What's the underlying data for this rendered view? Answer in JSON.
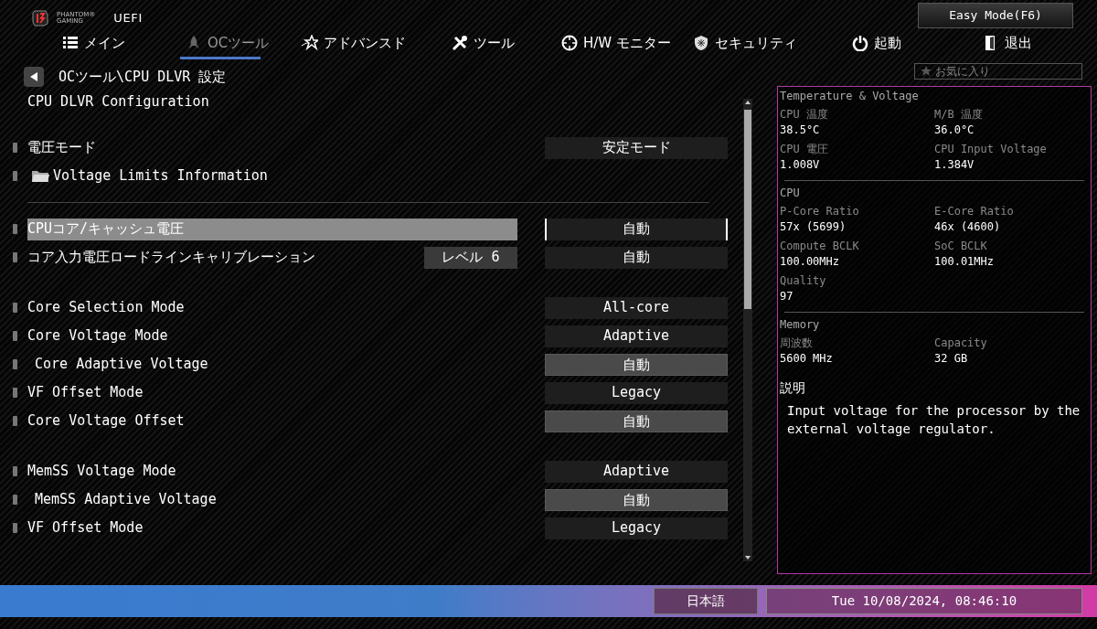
{
  "header": {
    "logo_brand": "PHANTOM®",
    "logo_sub": "GAMING",
    "product": "UEFI",
    "easy_mode_button": "Easy Mode(F6)"
  },
  "tabs": [
    {
      "label": "メイン",
      "selected": false
    },
    {
      "label": "OCツール",
      "selected": true
    },
    {
      "label": "アドバンスド",
      "selected": false
    },
    {
      "label": "ツール",
      "selected": false
    },
    {
      "label": "H/W モニター",
      "selected": false
    },
    {
      "label": "セキュリティ",
      "selected": false
    },
    {
      "label": "起動",
      "selected": false
    },
    {
      "label": "退出",
      "selected": false
    }
  ],
  "favorites": "お気に入り",
  "breadcrumb": "OCツール\\CPU DLVR 設定",
  "section_title": "CPU DLVR Configuration",
  "groups": [
    {
      "items": [
        {
          "kind": "option",
          "label": "電圧モード",
          "value": "安定モード",
          "editable": false,
          "selected": false
        },
        {
          "kind": "folder",
          "label": "Voltage Limits Information",
          "selected": false
        },
        {
          "kind": "divider"
        }
      ]
    },
    {
      "items": [
        {
          "kind": "option",
          "label": "CPUコア/キャッシュ電圧",
          "value": "自動",
          "editable": false,
          "selected": true
        },
        {
          "kind": "option",
          "label": "コア入力電圧ロードラインキャリブレーション",
          "reading": "レベル 6",
          "value": "自動",
          "editable": false,
          "selected": false
        }
      ]
    },
    {
      "items": [
        {
          "kind": "option",
          "label": "Core Selection Mode",
          "value": "All-core",
          "editable": false,
          "selected": false
        },
        {
          "kind": "option",
          "label": "Core Voltage Mode",
          "value": "Adaptive",
          "editable": false,
          "selected": false,
          "children": [
            {
              "kind": "option",
              "label": "Core Adaptive Voltage",
              "value": "自動",
              "editable": true,
              "selected": false
            }
          ]
        },
        {
          "kind": "option",
          "label": "VF Offset Mode",
          "value": "Legacy",
          "editable": false,
          "selected": false
        },
        {
          "kind": "option",
          "label": "Core Voltage Offset",
          "value": "自動",
          "editable": true,
          "selected": false
        }
      ]
    },
    {
      "items": [
        {
          "kind": "option",
          "label": "MemSS Voltage Mode",
          "value": "Adaptive",
          "editable": false,
          "selected": false,
          "children": [
            {
              "kind": "option",
              "label": "MemSS Adaptive Voltage",
              "value": "自動",
              "editable": true,
              "selected": false
            }
          ]
        },
        {
          "kind": "option",
          "label": "VF Offset Mode",
          "value": "Legacy",
          "editable": false,
          "selected": false
        }
      ]
    }
  ],
  "monitor": [
    {
      "title": "Temperature & Voltage",
      "fields": [
        {
          "label": "CPU 温度",
          "value": "38.5°C"
        },
        {
          "label": "M/B 温度",
          "value": "36.0°C"
        },
        {
          "label": "CPU 電圧",
          "value": "1.008V"
        },
        {
          "label": "CPU Input Voltage",
          "value": "1.384V"
        }
      ]
    },
    {
      "title": "CPU",
      "fields": [
        {
          "label": "P-Core Ratio",
          "value": "57x (5699)"
        },
        {
          "label": "E-Core Ratio",
          "value": "46x (4600)"
        },
        {
          "label": "Compute BCLK",
          "value": "100.00MHz"
        },
        {
          "label": "SoC BCLK",
          "value": "100.01MHz"
        },
        {
          "label": "Quality",
          "value": "97"
        }
      ]
    },
    {
      "title": "Memory",
      "fields": [
        {
          "label": "周波数",
          "value": "5600 MHz"
        },
        {
          "label": "Capacity",
          "value": "32 GB"
        }
      ]
    }
  ],
  "description": {
    "title": "説明",
    "text": "Input voltage for the processor by the external voltage regulator."
  },
  "status_bar": {
    "language": "日本語",
    "datetime": "Tue 10/08/2024, 08:46:10"
  }
}
